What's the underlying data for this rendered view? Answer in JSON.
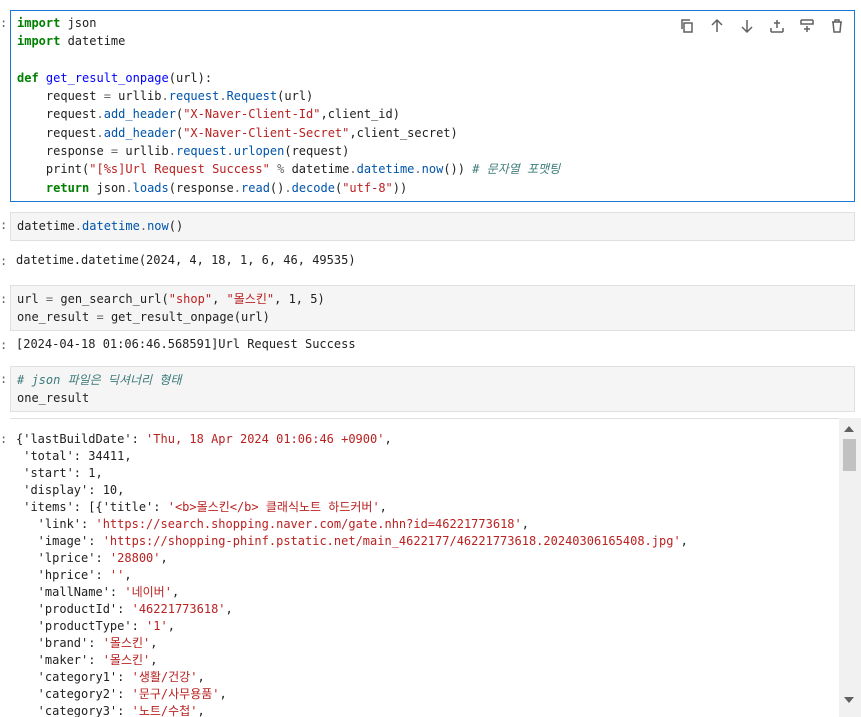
{
  "cell1": {
    "lines": [
      [
        {
          "t": "import",
          "c": "kw"
        },
        {
          "t": " json"
        }
      ],
      [
        {
          "t": "import",
          "c": "kw"
        },
        {
          "t": " datetime"
        }
      ],
      [],
      [
        {
          "t": "def",
          "c": "kw"
        },
        {
          "t": " "
        },
        {
          "t": "get_result_onpage",
          "c": "fn"
        },
        {
          "t": "(url):"
        }
      ],
      [
        {
          "t": "    request "
        },
        {
          "t": "=",
          "c": "op"
        },
        {
          "t": " urllib"
        },
        {
          "t": ".",
          "c": "op"
        },
        {
          "t": "request",
          "c": "attr"
        },
        {
          "t": ".",
          "c": "op"
        },
        {
          "t": "Request",
          "c": "attr"
        },
        {
          "t": "(url)"
        }
      ],
      [
        {
          "t": "    request"
        },
        {
          "t": ".",
          "c": "op"
        },
        {
          "t": "add_header",
          "c": "attr"
        },
        {
          "t": "("
        },
        {
          "t": "\"X-Naver-Client-Id\"",
          "c": "str"
        },
        {
          "t": ",client_id)"
        }
      ],
      [
        {
          "t": "    request"
        },
        {
          "t": ".",
          "c": "op"
        },
        {
          "t": "add_header",
          "c": "attr"
        },
        {
          "t": "("
        },
        {
          "t": "\"X-Naver-Client-Secret\"",
          "c": "str"
        },
        {
          "t": ",client_secret)"
        }
      ],
      [
        {
          "t": "    response "
        },
        {
          "t": "=",
          "c": "op"
        },
        {
          "t": " urllib"
        },
        {
          "t": ".",
          "c": "op"
        },
        {
          "t": "request",
          "c": "attr"
        },
        {
          "t": ".",
          "c": "op"
        },
        {
          "t": "urlopen",
          "c": "attr"
        },
        {
          "t": "(request)"
        }
      ],
      [
        {
          "t": "    print("
        },
        {
          "t": "\"[%s]Url Request Success\"",
          "c": "str"
        },
        {
          "t": " "
        },
        {
          "t": "%",
          "c": "op"
        },
        {
          "t": " datetime"
        },
        {
          "t": ".",
          "c": "op"
        },
        {
          "t": "datetime",
          "c": "attr"
        },
        {
          "t": ".",
          "c": "op"
        },
        {
          "t": "now",
          "c": "attr"
        },
        {
          "t": "()) "
        },
        {
          "t": "# 문자열 포맷팅",
          "c": "cm"
        }
      ],
      [
        {
          "t": "    "
        },
        {
          "t": "return",
          "c": "kw"
        },
        {
          "t": " json"
        },
        {
          "t": ".",
          "c": "op"
        },
        {
          "t": "loads",
          "c": "attr"
        },
        {
          "t": "(response"
        },
        {
          "t": ".",
          "c": "op"
        },
        {
          "t": "read",
          "c": "attr"
        },
        {
          "t": "()"
        },
        {
          "t": ".",
          "c": "op"
        },
        {
          "t": "decode",
          "c": "attr"
        },
        {
          "t": "("
        },
        {
          "t": "\"utf-8\"",
          "c": "str"
        },
        {
          "t": "))"
        }
      ]
    ]
  },
  "cell2": {
    "lines": [
      [
        {
          "t": "datetime"
        },
        {
          "t": ".",
          "c": "op"
        },
        {
          "t": "datetime",
          "c": "attr"
        },
        {
          "t": ".",
          "c": "op"
        },
        {
          "t": "now",
          "c": "attr"
        },
        {
          "t": "()"
        }
      ]
    ],
    "output": "datetime.datetime(2024, 4, 18, 1, 6, 46, 49535)"
  },
  "cell3": {
    "lines": [
      [
        {
          "t": "url "
        },
        {
          "t": "=",
          "c": "op"
        },
        {
          "t": " gen_search_url("
        },
        {
          "t": "\"shop\"",
          "c": "str"
        },
        {
          "t": ", "
        },
        {
          "t": "\"몰스킨\"",
          "c": "str"
        },
        {
          "t": ", 1, 5)"
        }
      ],
      [
        {
          "t": "one_result "
        },
        {
          "t": "=",
          "c": "op"
        },
        {
          "t": " get_result_onpage(url)"
        }
      ]
    ],
    "output": "[2024-04-18 01:06:46.568591]Url Request Success"
  },
  "cell4": {
    "lines": [
      [
        {
          "t": "# json 파일은 딕셔너리 형태",
          "c": "cm"
        }
      ],
      [
        {
          "t": "one_result"
        }
      ]
    ]
  },
  "output_lines": [
    [
      {
        "t": "{'lastBuildDate': "
      },
      {
        "t": "'Thu, 18 Apr 2024 01:06:46 +0900'",
        "c": "ostr"
      },
      {
        "t": ","
      }
    ],
    [
      {
        "t": " 'total': 34411,"
      }
    ],
    [
      {
        "t": " 'start': 1,"
      }
    ],
    [
      {
        "t": " 'display': 10,"
      }
    ],
    [
      {
        "t": " 'items': [{'title': "
      },
      {
        "t": "'<b>몰스킨</b> 클래식노트 하드커버'",
        "c": "ostr"
      },
      {
        "t": ","
      }
    ],
    [
      {
        "t": "   'link': "
      },
      {
        "t": "'https://search.shopping.naver.com/gate.nhn?id=46221773618'",
        "c": "ostr"
      },
      {
        "t": ","
      }
    ],
    [
      {
        "t": "   'image': "
      },
      {
        "t": "'https://shopping-phinf.pstatic.net/main_4622177/46221773618.20240306165408.jpg'",
        "c": "ostr"
      },
      {
        "t": ","
      }
    ],
    [
      {
        "t": "   'lprice': "
      },
      {
        "t": "'28800'",
        "c": "ostr"
      },
      {
        "t": ","
      }
    ],
    [
      {
        "t": "   'hprice': "
      },
      {
        "t": "''",
        "c": "ostr"
      },
      {
        "t": ","
      }
    ],
    [
      {
        "t": "   'mallName': "
      },
      {
        "t": "'네이버'",
        "c": "ostr"
      },
      {
        "t": ","
      }
    ],
    [
      {
        "t": "   'productId': "
      },
      {
        "t": "'46221773618'",
        "c": "ostr"
      },
      {
        "t": ","
      }
    ],
    [
      {
        "t": "   'productType': "
      },
      {
        "t": "'1'",
        "c": "ostr"
      },
      {
        "t": ","
      }
    ],
    [
      {
        "t": "   'brand': "
      },
      {
        "t": "'몰스킨'",
        "c": "ostr"
      },
      {
        "t": ","
      }
    ],
    [
      {
        "t": "   'maker': "
      },
      {
        "t": "'몰스킨'",
        "c": "ostr"
      },
      {
        "t": ","
      }
    ],
    [
      {
        "t": "   'category1': "
      },
      {
        "t": "'생활/건강'",
        "c": "ostr"
      },
      {
        "t": ","
      }
    ],
    [
      {
        "t": "   'category2': "
      },
      {
        "t": "'문구/사무용품'",
        "c": "ostr"
      },
      {
        "t": ","
      }
    ],
    [
      {
        "t": "   'category3': "
      },
      {
        "t": "'노트/수첩'",
        "c": "ostr"
      },
      {
        "t": ","
      }
    ]
  ],
  "toolbar": {
    "icons": [
      "duplicate-icon",
      "move-up-icon",
      "move-down-icon",
      "insert-above-icon",
      "insert-below-icon",
      "delete-icon"
    ]
  },
  "colors": {
    "active_border": "#1976d2",
    "keyword": "#008000",
    "string": "#ba2121",
    "comment": "#3d7b7b"
  }
}
